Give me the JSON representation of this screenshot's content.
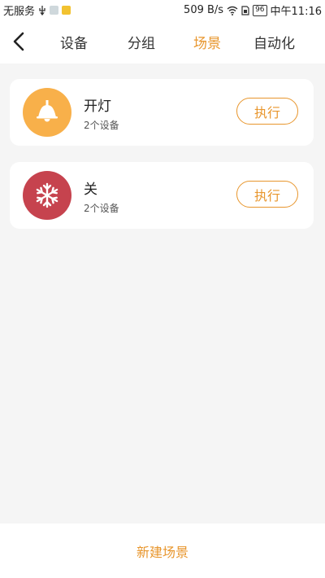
{
  "status_bar": {
    "carrier": "无服务",
    "speed": "509 B/s",
    "battery": "96",
    "time": "中午11:16"
  },
  "nav": {
    "tabs": [
      {
        "label": "设备",
        "active": false
      },
      {
        "label": "分组",
        "active": false
      },
      {
        "label": "场景",
        "active": true
      },
      {
        "label": "自动化",
        "active": false
      }
    ]
  },
  "scenes": [
    {
      "name": "开灯",
      "devices": "2个设备",
      "action": "执行",
      "icon": "lamp-icon",
      "icon_color": "#f8b04a"
    },
    {
      "name": "关",
      "devices": "2个设备",
      "action": "执行",
      "icon": "snowflake-icon",
      "icon_color": "#c6434e"
    }
  ],
  "bottom": {
    "new_scene": "新建场景"
  },
  "colors": {
    "accent": "#e8962d",
    "background": "#f5f5f5"
  }
}
